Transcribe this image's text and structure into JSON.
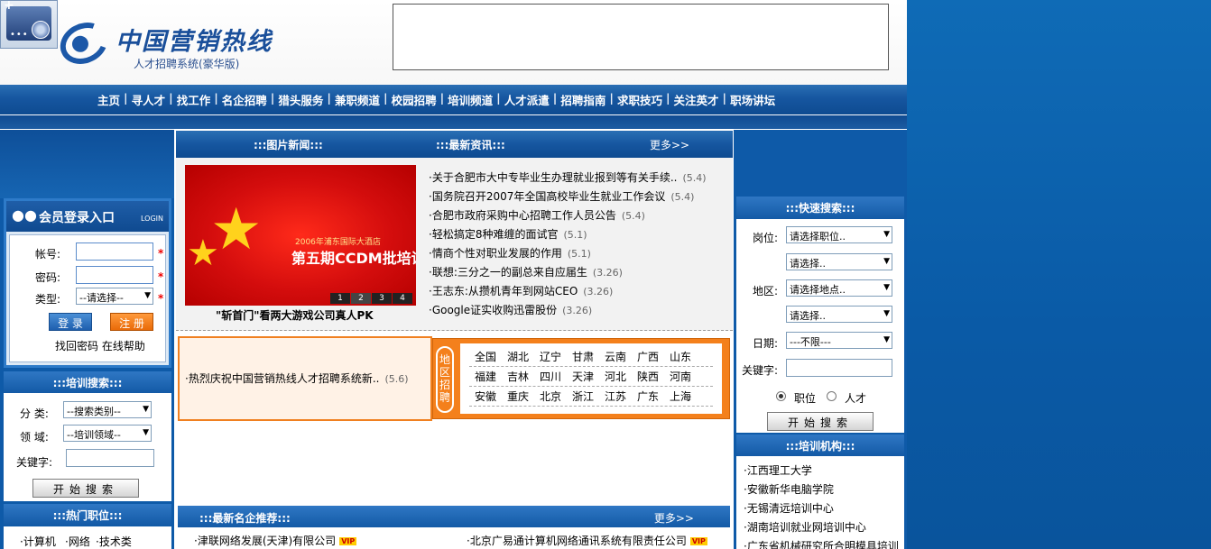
{
  "header": {
    "logo_title": "中国营销热线",
    "logo_subtitle": "人才招聘系统(豪华版)"
  },
  "nav": {
    "items": [
      "主页",
      "寻人才",
      "找工作",
      "名企招聘",
      "猎头服务",
      "兼职频道",
      "校园招聘",
      "培训频道",
      "人才派遣",
      "招聘指南",
      "求职技巧",
      "关注英才",
      "职场讲坛"
    ],
    "separator": "|"
  },
  "login": {
    "title": "会员登录入口",
    "title_en": "LOGIN",
    "account_label": "帐号:",
    "password_label": "密码:",
    "type_label": "类型:",
    "type_select": "--请选择--",
    "required_mark": "*",
    "login_button": "登 录",
    "register_button": "注 册",
    "forgot_password": "找回密码",
    "online_help": "在线帮助"
  },
  "training_search": {
    "title": ":::培训搜索:::",
    "category_label": "分  类:",
    "category_select": "--搜索类别--",
    "field_label": "领  域:",
    "field_select": "--培训领域--",
    "keyword_label": "关键字:",
    "search_button": "开始搜索"
  },
  "hot_jobs": {
    "title": ":::热门职位:::",
    "items": [
      "·计算机",
      "·网络",
      "·技术类"
    ]
  },
  "center": {
    "photo_news_title": ":::图片新闻:::",
    "latest_news_title": ":::最新资讯:::",
    "more": "更多>>",
    "photo": {
      "subtitle": "2006年浦东国际大酒店",
      "headline": "第五期CCDM批培训",
      "pages": [
        "1",
        "2",
        "3",
        "4"
      ],
      "caption": "\"斩首门\"看两大游戏公司真人PK"
    },
    "news": [
      {
        "title": "·关于合肥市大中专毕业生办理就业报到等有关手续..",
        "date": "(5.4)"
      },
      {
        "title": "·国务院召开2007年全国高校毕业生就业工作会议",
        "date": "(5.4)"
      },
      {
        "title": "·合肥市政府采购中心招聘工作人员公告",
        "date": "(5.4)"
      },
      {
        "title": "·轻松搞定8种难缠的面试官",
        "date": "(5.1)"
      },
      {
        "title": "·情商个性对职业发展的作用",
        "date": "(5.1)"
      },
      {
        "title": "·联想:三分之一的副总来自应届生",
        "date": "(3.26)"
      },
      {
        "title": "·王志东:从攒机青年到网站CEO",
        "date": "(3.26)"
      },
      {
        "title": "·Google证实收购迅雷股份",
        "date": "(3.26)"
      }
    ],
    "announcement": {
      "title": "·热烈庆祝中国营销热线人才招聘系统新..",
      "date": "(5.6)"
    },
    "region": {
      "tab": "地区招聘",
      "rows": [
        [
          "全国",
          "湖北",
          "辽宁",
          "甘肃",
          "云南",
          "广西",
          "山东"
        ],
        [
          "福建",
          "吉林",
          "四川",
          "天津",
          "河北",
          "陕西",
          "河南"
        ],
        [
          "安徽",
          "重庆",
          "北京",
          "浙江",
          "江苏",
          "广东",
          "上海"
        ]
      ]
    },
    "recommend": {
      "title": ":::最新名企推荐:::",
      "more": "更多>>",
      "items": [
        "·津联网络发展(天津)有限公司",
        "·北京广易通计算机网络通讯系统有限责任公司"
      ],
      "badge": "VIP"
    }
  },
  "quick_search": {
    "title": ":::快速搜索:::",
    "position_label": "岗位:",
    "position_select": "请选择职位..",
    "position_sub_select": "请选择..",
    "area_label": "地区:",
    "area_select": "请选择地点..",
    "area_sub_select": "请选择..",
    "date_label": "日期:",
    "date_select": "---不限---",
    "keyword_label": "关键字:",
    "radio_position": "职位",
    "radio_talent": "人才",
    "search_button": "开始搜索"
  },
  "training_orgs": {
    "title": ":::培训机构:::",
    "items": [
      "·江西理工大学",
      "·安徽新华电脑学院",
      "·无锡清远培训中心",
      "·湖南培训就业网培训中心",
      "·广东省机械研究所合明模具培训"
    ]
  },
  "colors": {
    "nav_blue": "#1656a0",
    "accent_orange": "#f4801c",
    "side_blue": "#0e5aa8"
  }
}
